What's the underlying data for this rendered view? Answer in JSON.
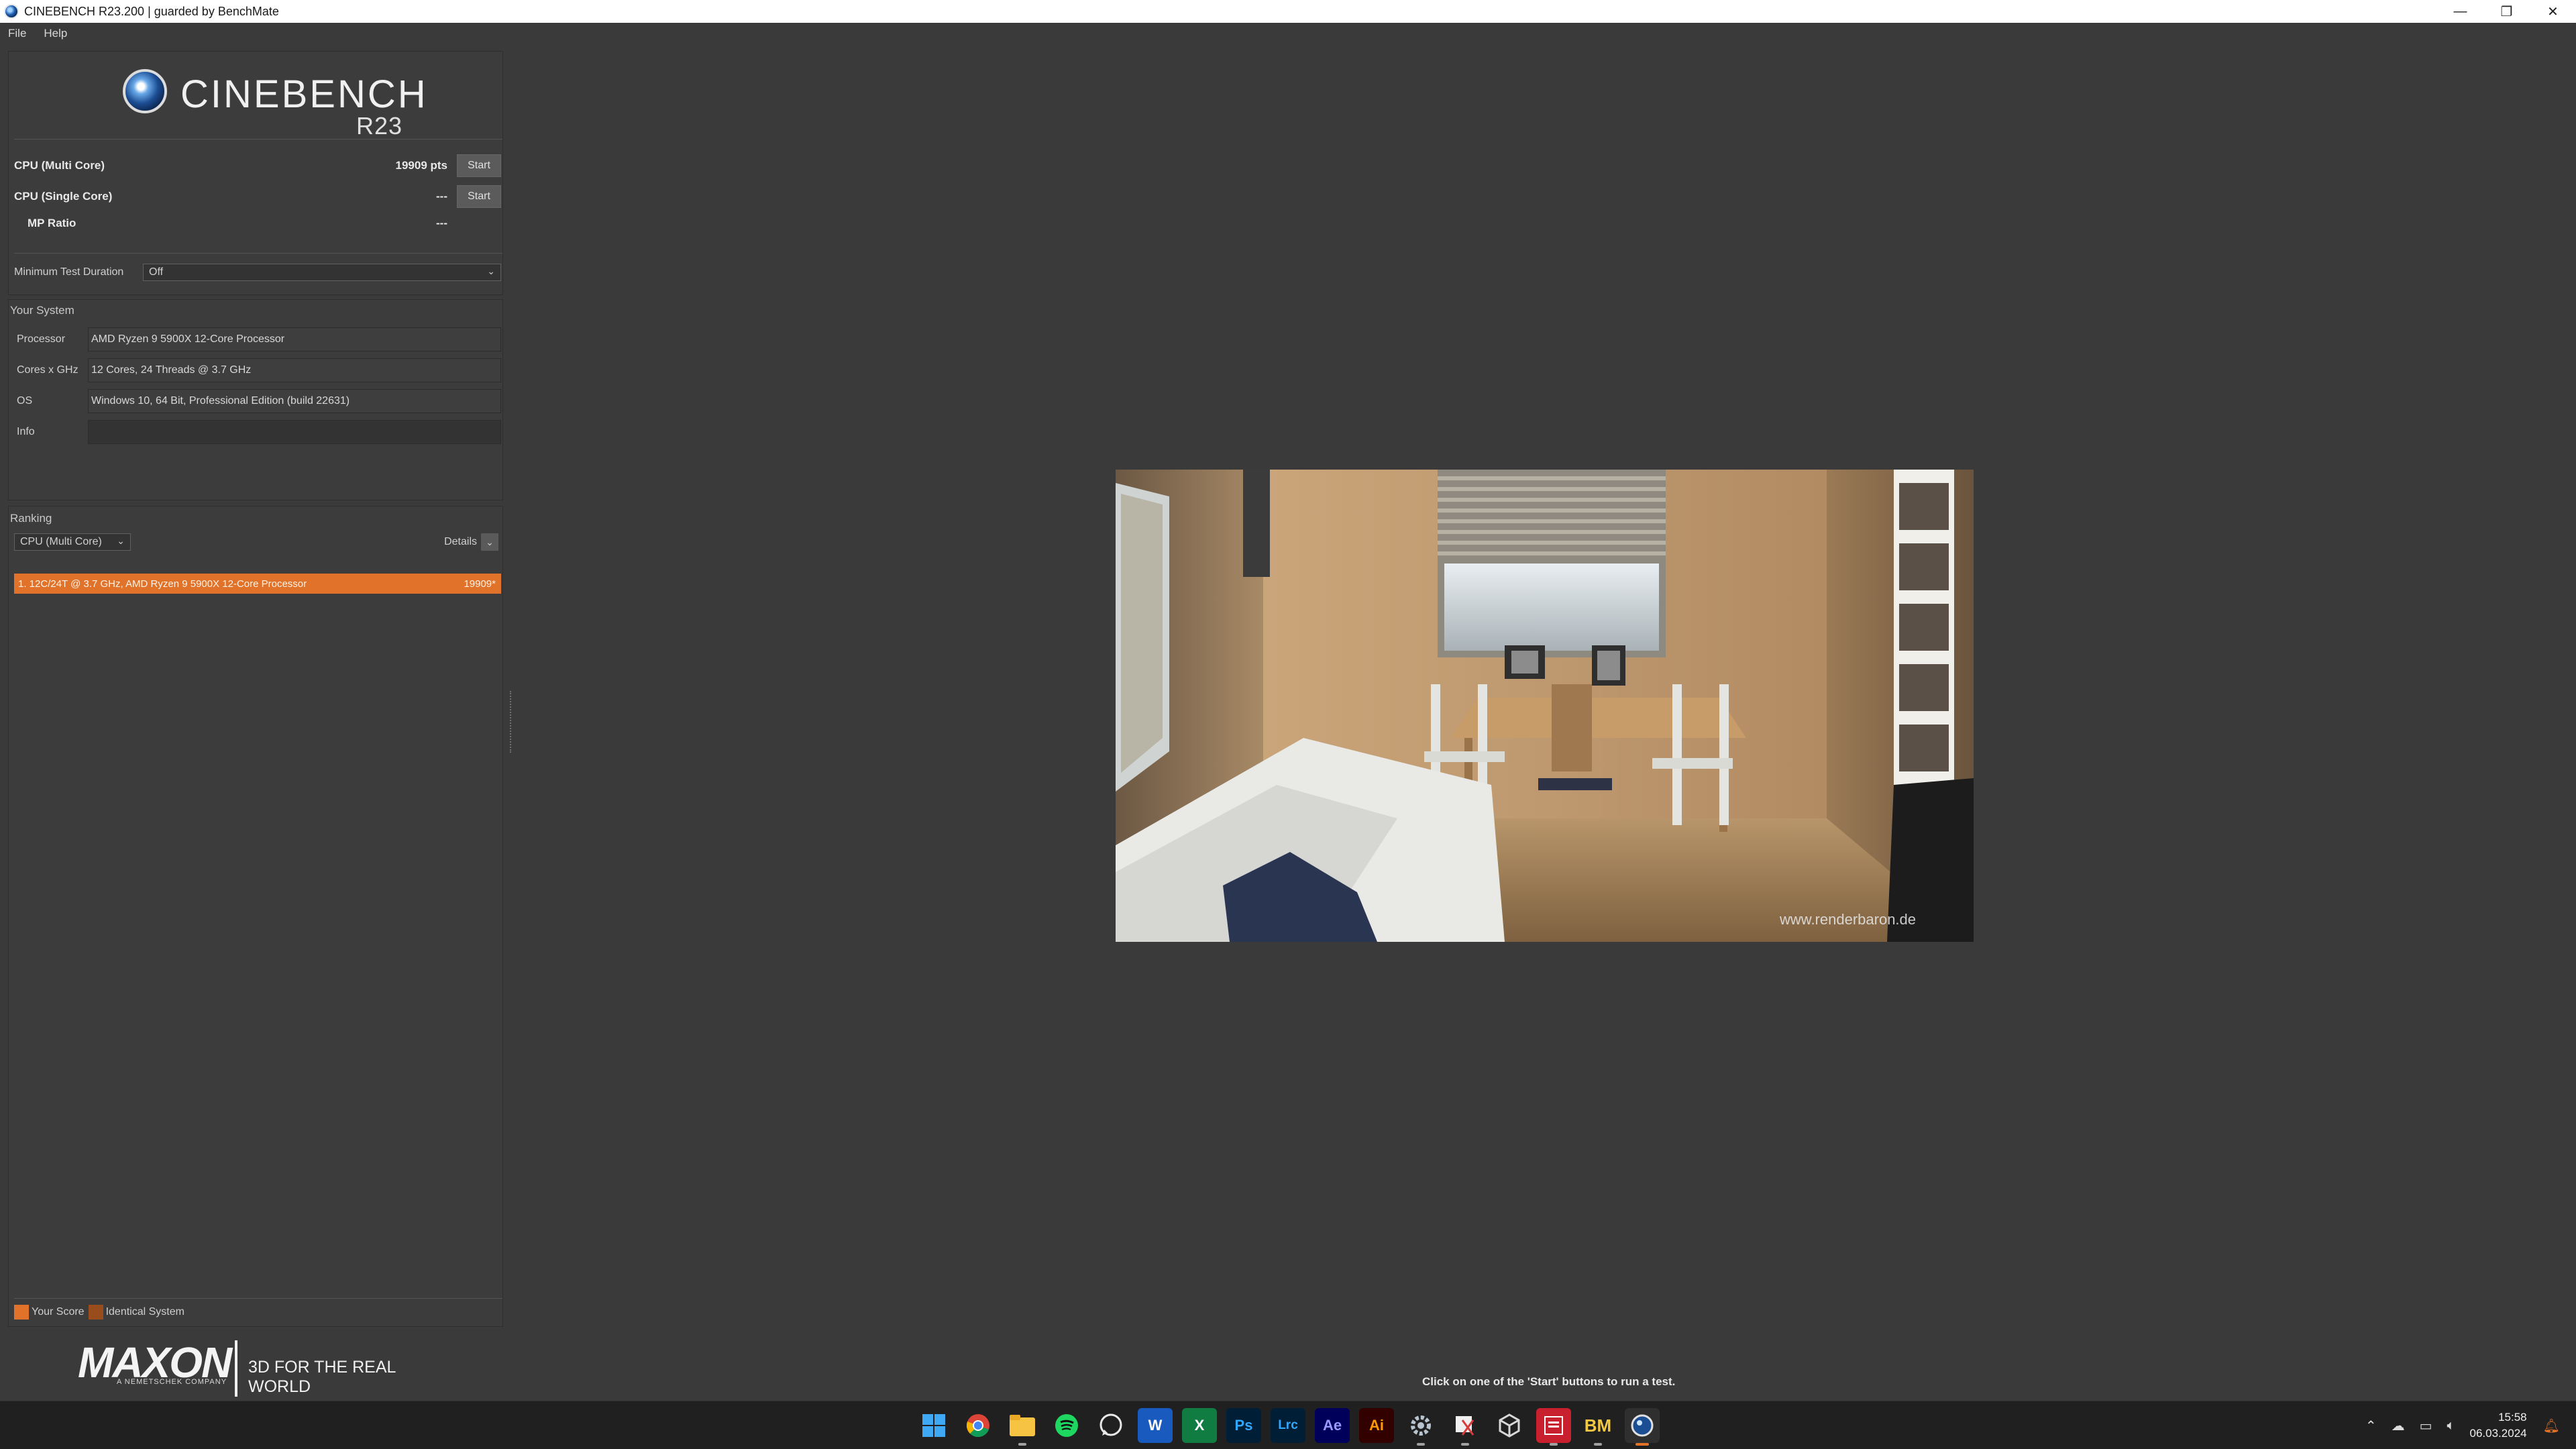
{
  "window": {
    "title": "CINEBENCH R23.200 | guarded by BenchMate",
    "minimize": "—",
    "restore": "❐",
    "close": "✕"
  },
  "menu": {
    "file": "File",
    "help": "Help"
  },
  "logo": {
    "name": "CINEBENCH",
    "version": "R23"
  },
  "tests": {
    "multi": {
      "label": "CPU (Multi Core)",
      "score": "19909 pts",
      "start": "Start"
    },
    "single": {
      "label": "CPU (Single Core)",
      "score": "---",
      "start": "Start"
    },
    "mp_ratio": {
      "label": "MP Ratio",
      "value": "---"
    }
  },
  "duration": {
    "label": "Minimum Test Duration",
    "value": "Off"
  },
  "system": {
    "header": "Your System",
    "rows": [
      {
        "label": "Processor",
        "value": "AMD Ryzen 9 5900X 12-Core Processor"
      },
      {
        "label": "Cores x GHz",
        "value": "12 Cores, 24 Threads @ 3.7 GHz"
      },
      {
        "label": "OS",
        "value": "Windows 10, 64 Bit, Professional Edition (build 22631)"
      },
      {
        "label": "Info",
        "value": ""
      }
    ]
  },
  "ranking": {
    "header": "Ranking",
    "filter": "CPU (Multi Core)",
    "details": "Details",
    "entries": [
      {
        "text": "1. 12C/24T @ 3.7 GHz, AMD Ryzen 9 5900X 12-Core Processor",
        "score": "19909*"
      }
    ],
    "legend": {
      "your_score": "Your Score",
      "identical": "Identical System"
    }
  },
  "footer": {
    "brand": "MAXON",
    "sub": "A NEMETSCHEK COMPANY",
    "tagline": "3D FOR THE REAL WORLD",
    "status": "Click on one of the 'Start' buttons to run a test."
  },
  "render": {
    "watermark": "www.renderbaron.de"
  },
  "taskbar": {
    "icons": [
      "windows-start",
      "chrome",
      "file-explorer",
      "spotify",
      "whatsapp",
      "word",
      "excel",
      "photoshop",
      "lightroom-classic",
      "after-effects",
      "illustrator",
      "settings",
      "snipping-tool",
      "unity",
      "pdf-app",
      "benchmate",
      "cinebench"
    ],
    "labels": {
      "ps": "Ps",
      "lrc": "Lrc",
      "ae": "Ae",
      "ai": "Ai",
      "bm": "BM",
      "w": "W",
      "x": "X"
    },
    "time": "15:58",
    "date": "06.03.2024"
  },
  "colors": {
    "accent": "#e0722a",
    "identical": "#9a4d1c",
    "background": "#3a3a3a"
  }
}
